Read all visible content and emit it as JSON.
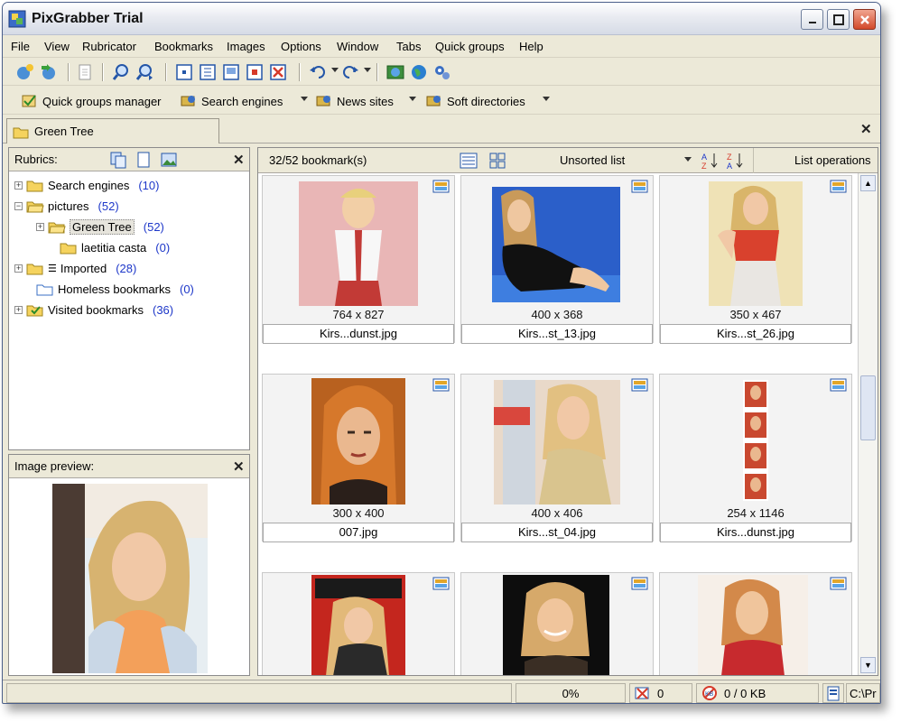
{
  "window": {
    "title": "PixGrabber Trial"
  },
  "menu": [
    "File",
    "View",
    "Rubricator",
    "Bookmarks",
    "Images",
    "Options",
    "Window",
    "Tabs",
    "Quick groups",
    "Help"
  ],
  "toolbar2": {
    "quick_groups": "Quick groups manager",
    "search_engines": "Search engines",
    "news_sites": "News sites",
    "soft_directories": "Soft directories"
  },
  "tab": {
    "label": "Green Tree"
  },
  "rubrics": {
    "header": "Rubrics:",
    "items": [
      {
        "label": "Search engines",
        "count": "(10)"
      },
      {
        "label": "pictures",
        "count": "(52)"
      },
      {
        "label": "Green Tree",
        "count": "(52)"
      },
      {
        "label": "laetitia casta",
        "count": "(0)"
      },
      {
        "label": "Imported",
        "count": "(28)"
      },
      {
        "label": "Homeless bookmarks",
        "count": "(0)"
      },
      {
        "label": "Visited bookmarks",
        "count": "(36)"
      }
    ]
  },
  "preview": {
    "header": "Image preview:"
  },
  "list": {
    "count": "32/52 bookmark(s)",
    "sort": "Unsorted list",
    "operations": "List operations"
  },
  "cards": [
    {
      "dims": "764 x 827",
      "name": "Kirs...dunst.jpg"
    },
    {
      "dims": "400 x 368",
      "name": "Kirs...st_13.jpg"
    },
    {
      "dims": "350 x 467",
      "name": "Kirs...st_26.jpg"
    },
    {
      "dims": "300 x 400",
      "name": "007.jpg"
    },
    {
      "dims": "400 x 406",
      "name": "Kirs...st_04.jpg"
    },
    {
      "dims": "254 x 1146",
      "name": "Kirs...dunst.jpg"
    },
    {
      "dims": "",
      "name": ""
    },
    {
      "dims": "",
      "name": ""
    },
    {
      "dims": "",
      "name": ""
    }
  ],
  "status": {
    "percent": "0%",
    "errors": "0",
    "downloads": "0 / 0 KB",
    "path": "C:\\Pr"
  }
}
